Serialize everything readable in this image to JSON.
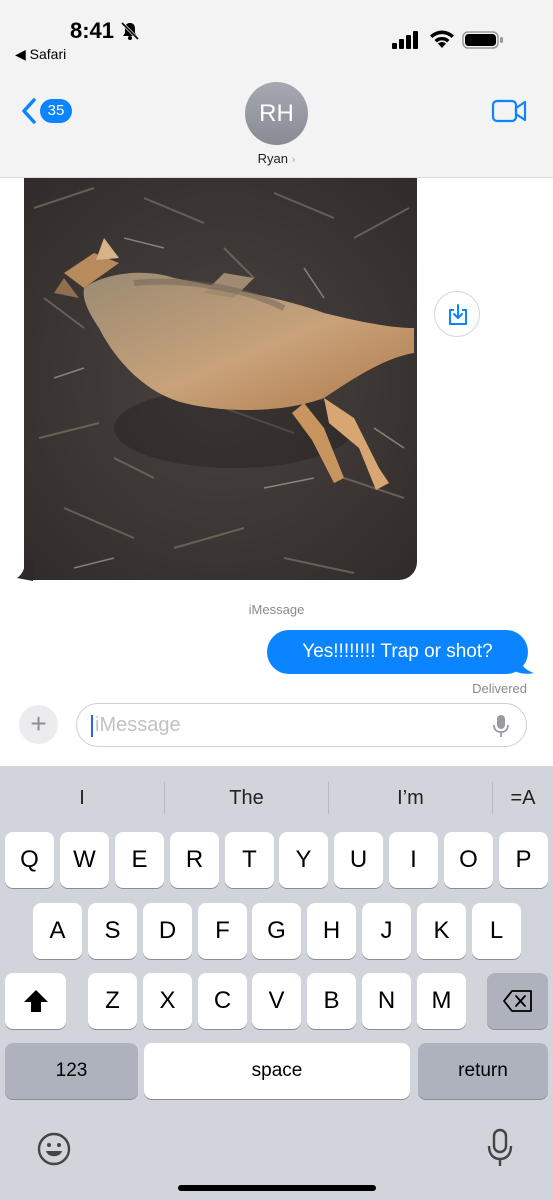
{
  "status_bar": {
    "time": "8:41",
    "back_app": "◀ Safari"
  },
  "header": {
    "back_count": "35",
    "avatar_initials": "RH",
    "contact_name": "Ryan",
    "contact_chevron": "›"
  },
  "messages": {
    "service_label": "iMessage",
    "outgoing_text": "Yes!!!!!!!!  Trap or shot?",
    "delivery_status": "Delivered"
  },
  "composer": {
    "plus_label": "+",
    "placeholder": "iMessage"
  },
  "keyboard": {
    "suggestions": [
      "I",
      "The",
      "I’m"
    ],
    "dictation_icon": "=A",
    "row1": [
      "Q",
      "W",
      "E",
      "R",
      "T",
      "Y",
      "U",
      "I",
      "O",
      "P"
    ],
    "row2": [
      "A",
      "S",
      "D",
      "F",
      "G",
      "H",
      "J",
      "K",
      "L"
    ],
    "row3": [
      "Z",
      "X",
      "C",
      "V",
      "B",
      "N",
      "M"
    ],
    "numbers_label": "123",
    "space_label": "space",
    "return_label": "return"
  },
  "colors": {
    "accent": "#0b84ff",
    "keyboard_bg": "#d2d4dc",
    "dark_key": "#aeb2bd"
  },
  "icons": [
    "bell-slash-icon",
    "signal-icon",
    "wifi-icon",
    "battery-icon",
    "chevron-left-icon",
    "video-camera-icon",
    "save-photo-icon",
    "microphone-icon",
    "shift-icon",
    "backspace-icon",
    "emoji-icon"
  ]
}
